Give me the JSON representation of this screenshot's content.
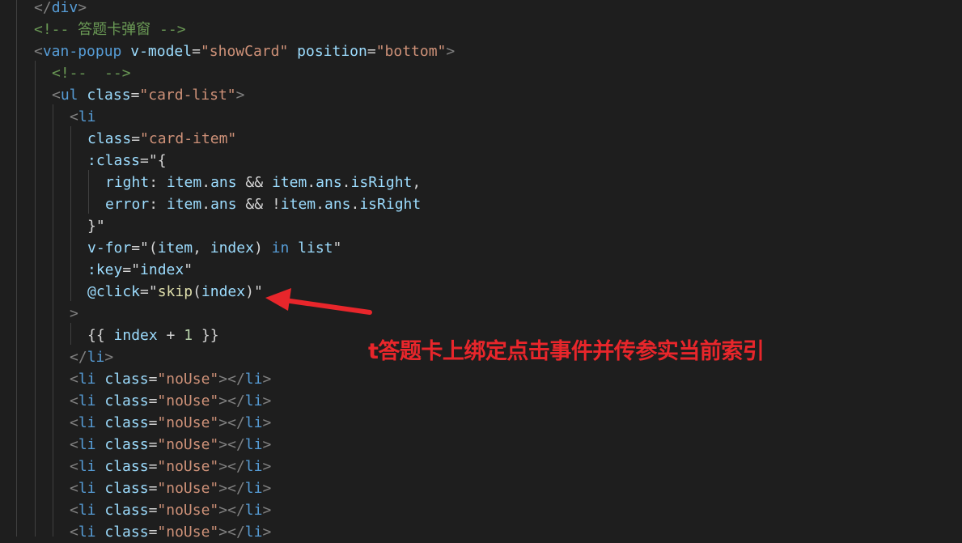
{
  "editor": {
    "lines": [
      {
        "indent": 42,
        "tokens": [
          {
            "t": "</",
            "c": "br"
          },
          {
            "t": "div",
            "c": "tag"
          },
          {
            "t": ">",
            "c": "br"
          }
        ]
      },
      {
        "indent": 42,
        "tokens": [
          {
            "t": "<!-- 答题卡弹窗 -->",
            "c": "cmt"
          }
        ]
      },
      {
        "indent": 42,
        "tokens": [
          {
            "t": "<",
            "c": "br"
          },
          {
            "t": "van-popup",
            "c": "tag"
          },
          {
            "t": " ",
            "c": "plain"
          },
          {
            "t": "v-model",
            "c": "attr"
          },
          {
            "t": "=",
            "c": "plain"
          },
          {
            "t": "\"showCard\"",
            "c": "str"
          },
          {
            "t": " ",
            "c": "plain"
          },
          {
            "t": "position",
            "c": "attr"
          },
          {
            "t": "=",
            "c": "plain"
          },
          {
            "t": "\"bottom\"",
            "c": "str"
          },
          {
            "t": ">",
            "c": "br"
          }
        ]
      },
      {
        "indent": 64,
        "tokens": [
          {
            "t": "<!--  -->",
            "c": "cmt"
          }
        ]
      },
      {
        "indent": 64,
        "tokens": [
          {
            "t": "<",
            "c": "br"
          },
          {
            "t": "ul",
            "c": "tag"
          },
          {
            "t": " ",
            "c": "plain"
          },
          {
            "t": "class",
            "c": "attr"
          },
          {
            "t": "=",
            "c": "plain"
          },
          {
            "t": "\"card-list\"",
            "c": "str"
          },
          {
            "t": ">",
            "c": "br"
          }
        ]
      },
      {
        "indent": 86,
        "tokens": [
          {
            "t": "<",
            "c": "br"
          },
          {
            "t": "li",
            "c": "tag"
          }
        ]
      },
      {
        "indent": 108,
        "tokens": [
          {
            "t": "class",
            "c": "attr"
          },
          {
            "t": "=",
            "c": "plain"
          },
          {
            "t": "\"card-item\"",
            "c": "str"
          }
        ]
      },
      {
        "indent": 108,
        "tokens": [
          {
            "t": ":class",
            "c": "attr"
          },
          {
            "t": "=\"{",
            "c": "plain"
          }
        ]
      },
      {
        "indent": 130,
        "tokens": [
          {
            "t": "right",
            "c": "attr"
          },
          {
            "t": ": ",
            "c": "plain"
          },
          {
            "t": "item",
            "c": "attr"
          },
          {
            "t": ".",
            "c": "plain"
          },
          {
            "t": "ans",
            "c": "attr"
          },
          {
            "t": " && ",
            "c": "plain"
          },
          {
            "t": "item",
            "c": "attr"
          },
          {
            "t": ".",
            "c": "plain"
          },
          {
            "t": "ans",
            "c": "attr"
          },
          {
            "t": ".",
            "c": "plain"
          },
          {
            "t": "isRight",
            "c": "attr"
          },
          {
            "t": ",",
            "c": "plain"
          }
        ]
      },
      {
        "indent": 130,
        "tokens": [
          {
            "t": "error",
            "c": "attr"
          },
          {
            "t": ": ",
            "c": "plain"
          },
          {
            "t": "item",
            "c": "attr"
          },
          {
            "t": ".",
            "c": "plain"
          },
          {
            "t": "ans",
            "c": "attr"
          },
          {
            "t": " && !",
            "c": "plain"
          },
          {
            "t": "item",
            "c": "attr"
          },
          {
            "t": ".",
            "c": "plain"
          },
          {
            "t": "ans",
            "c": "attr"
          },
          {
            "t": ".",
            "c": "plain"
          },
          {
            "t": "isRight",
            "c": "attr"
          }
        ]
      },
      {
        "indent": 108,
        "tokens": [
          {
            "t": "}\"",
            "c": "plain"
          }
        ]
      },
      {
        "indent": 108,
        "tokens": [
          {
            "t": "v-for",
            "c": "attr"
          },
          {
            "t": "=\"(",
            "c": "plain"
          },
          {
            "t": "item",
            "c": "attr"
          },
          {
            "t": ", ",
            "c": "plain"
          },
          {
            "t": "index",
            "c": "attr"
          },
          {
            "t": ") ",
            "c": "plain"
          },
          {
            "t": "in",
            "c": "kw"
          },
          {
            "t": " ",
            "c": "plain"
          },
          {
            "t": "list",
            "c": "attr"
          },
          {
            "t": "\"",
            "c": "plain"
          }
        ]
      },
      {
        "indent": 108,
        "tokens": [
          {
            "t": ":key",
            "c": "attr"
          },
          {
            "t": "=\"",
            "c": "plain"
          },
          {
            "t": "index",
            "c": "attr"
          },
          {
            "t": "\"",
            "c": "plain"
          }
        ]
      },
      {
        "indent": 108,
        "tokens": [
          {
            "t": "@click",
            "c": "attr"
          },
          {
            "t": "=\"",
            "c": "plain"
          },
          {
            "t": "skip",
            "c": "fn"
          },
          {
            "t": "(",
            "c": "plain"
          },
          {
            "t": "index",
            "c": "attr"
          },
          {
            "t": ")\"",
            "c": "plain"
          }
        ]
      },
      {
        "indent": 86,
        "tokens": [
          {
            "t": ">",
            "c": "br"
          }
        ]
      },
      {
        "indent": 108,
        "tokens": [
          {
            "t": "{{ ",
            "c": "plain"
          },
          {
            "t": "index",
            "c": "attr"
          },
          {
            "t": " + ",
            "c": "plain"
          },
          {
            "t": "1",
            "c": "num"
          },
          {
            "t": " }}",
            "c": "plain"
          }
        ]
      },
      {
        "indent": 86,
        "tokens": [
          {
            "t": "</",
            "c": "br"
          },
          {
            "t": "li",
            "c": "tag"
          },
          {
            "t": ">",
            "c": "br"
          }
        ]
      },
      {
        "indent": 86,
        "tokens": [
          {
            "t": "<",
            "c": "br"
          },
          {
            "t": "li",
            "c": "tag"
          },
          {
            "t": " ",
            "c": "plain"
          },
          {
            "t": "class",
            "c": "attr"
          },
          {
            "t": "=",
            "c": "plain"
          },
          {
            "t": "\"noUse\"",
            "c": "str"
          },
          {
            "t": "></",
            "c": "br"
          },
          {
            "t": "li",
            "c": "tag"
          },
          {
            "t": ">",
            "c": "br"
          }
        ]
      },
      {
        "indent": 86,
        "tokens": [
          {
            "t": "<",
            "c": "br"
          },
          {
            "t": "li",
            "c": "tag"
          },
          {
            "t": " ",
            "c": "plain"
          },
          {
            "t": "class",
            "c": "attr"
          },
          {
            "t": "=",
            "c": "plain"
          },
          {
            "t": "\"noUse\"",
            "c": "str"
          },
          {
            "t": "></",
            "c": "br"
          },
          {
            "t": "li",
            "c": "tag"
          },
          {
            "t": ">",
            "c": "br"
          }
        ]
      },
      {
        "indent": 86,
        "tokens": [
          {
            "t": "<",
            "c": "br"
          },
          {
            "t": "li",
            "c": "tag"
          },
          {
            "t": " ",
            "c": "plain"
          },
          {
            "t": "class",
            "c": "attr"
          },
          {
            "t": "=",
            "c": "plain"
          },
          {
            "t": "\"noUse\"",
            "c": "str"
          },
          {
            "t": "></",
            "c": "br"
          },
          {
            "t": "li",
            "c": "tag"
          },
          {
            "t": ">",
            "c": "br"
          }
        ]
      },
      {
        "indent": 86,
        "tokens": [
          {
            "t": "<",
            "c": "br"
          },
          {
            "t": "li",
            "c": "tag"
          },
          {
            "t": " ",
            "c": "plain"
          },
          {
            "t": "class",
            "c": "attr"
          },
          {
            "t": "=",
            "c": "plain"
          },
          {
            "t": "\"noUse\"",
            "c": "str"
          },
          {
            "t": "></",
            "c": "br"
          },
          {
            "t": "li",
            "c": "tag"
          },
          {
            "t": ">",
            "c": "br"
          }
        ]
      },
      {
        "indent": 86,
        "tokens": [
          {
            "t": "<",
            "c": "br"
          },
          {
            "t": "li",
            "c": "tag"
          },
          {
            "t": " ",
            "c": "plain"
          },
          {
            "t": "class",
            "c": "attr"
          },
          {
            "t": "=",
            "c": "plain"
          },
          {
            "t": "\"noUse\"",
            "c": "str"
          },
          {
            "t": "></",
            "c": "br"
          },
          {
            "t": "li",
            "c": "tag"
          },
          {
            "t": ">",
            "c": "br"
          }
        ]
      },
      {
        "indent": 86,
        "tokens": [
          {
            "t": "<",
            "c": "br"
          },
          {
            "t": "li",
            "c": "tag"
          },
          {
            "t": " ",
            "c": "plain"
          },
          {
            "t": "class",
            "c": "attr"
          },
          {
            "t": "=",
            "c": "plain"
          },
          {
            "t": "\"noUse\"",
            "c": "str"
          },
          {
            "t": "></",
            "c": "br"
          },
          {
            "t": "li",
            "c": "tag"
          },
          {
            "t": ">",
            "c": "br"
          }
        ]
      },
      {
        "indent": 86,
        "tokens": [
          {
            "t": "<",
            "c": "br"
          },
          {
            "t": "li",
            "c": "tag"
          },
          {
            "t": " ",
            "c": "plain"
          },
          {
            "t": "class",
            "c": "attr"
          },
          {
            "t": "=",
            "c": "plain"
          },
          {
            "t": "\"noUse\"",
            "c": "str"
          },
          {
            "t": "></",
            "c": "br"
          },
          {
            "t": "li",
            "c": "tag"
          },
          {
            "t": ">",
            "c": "br"
          }
        ]
      },
      {
        "indent": 86,
        "tokens": [
          {
            "t": "<",
            "c": "br"
          },
          {
            "t": "li",
            "c": "tag"
          },
          {
            "t": " ",
            "c": "plain"
          },
          {
            "t": "class",
            "c": "attr"
          },
          {
            "t": "=",
            "c": "plain"
          },
          {
            "t": "\"noUse\"",
            "c": "str"
          },
          {
            "t": "></",
            "c": "br"
          },
          {
            "t": "li",
            "c": "tag"
          },
          {
            "t": ">",
            "c": "br"
          }
        ]
      }
    ]
  },
  "annotation": {
    "text": "t答题卡上绑定点击事件并传参实当前索引",
    "color": "#e8262b"
  },
  "colors": {
    "background": "#1e1e1e",
    "tag": "#569cd6",
    "bracket": "#808080",
    "attribute": "#9cdcfe",
    "string": "#ce9178",
    "comment": "#6a9955",
    "function": "#dcdcaa",
    "number": "#b5cea8"
  }
}
